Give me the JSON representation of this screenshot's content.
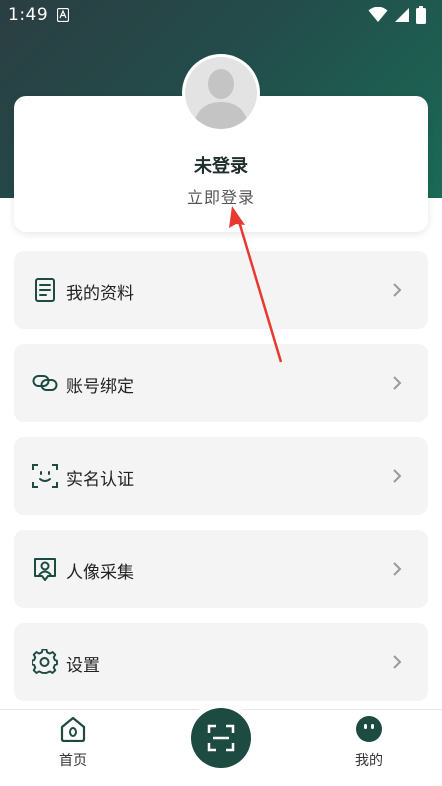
{
  "status_bar": {
    "time": "1:49"
  },
  "profile": {
    "name": "未登录",
    "login_prompt": "立即登录"
  },
  "menu": {
    "items": [
      {
        "label": "我的资料",
        "icon": "profile-document-icon"
      },
      {
        "label": "账号绑定",
        "icon": "link-icon"
      },
      {
        "label": "实名认证",
        "icon": "face-scan-icon"
      },
      {
        "label": "人像采集",
        "icon": "portrait-icon"
      },
      {
        "label": "设置",
        "icon": "gear-icon"
      }
    ]
  },
  "bottom_nav": {
    "home_label": "首页",
    "mine_label": "我的"
  },
  "colors": {
    "accent": "#1d4b41",
    "header_gradient_start": "#2b3e42",
    "header_gradient_end": "#1a6a56",
    "annotation_arrow": "#e8382f"
  }
}
